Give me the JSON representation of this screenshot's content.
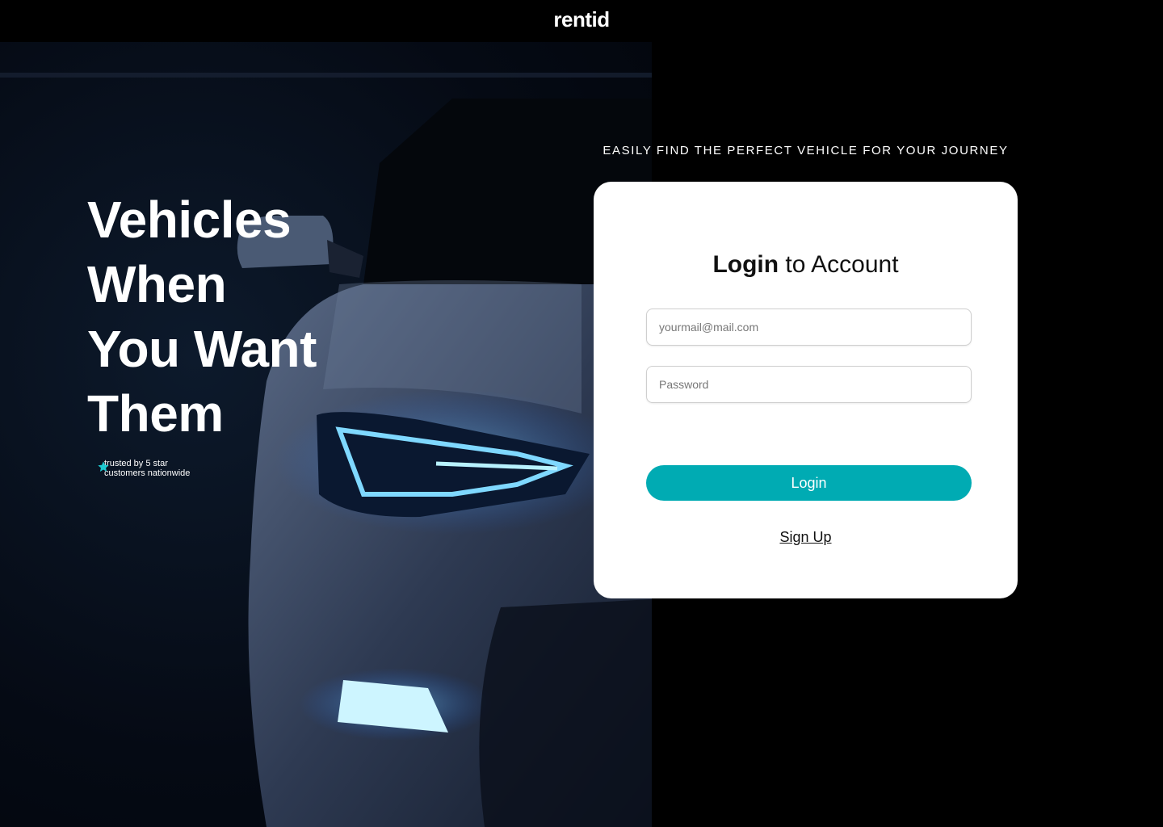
{
  "header": {
    "logo": "rentid"
  },
  "hero": {
    "headline_lines": [
      "Vehicles",
      "When",
      "You Want",
      "Them"
    ],
    "trust_icon": "star-icon",
    "trust_text_line1": "trusted by 5 star",
    "trust_text_line2": "customers nationwide"
  },
  "login": {
    "tagline": "EASILY FIND THE PERFECT VEHICLE FOR YOUR JOURNEY",
    "title_bold": "Login",
    "title_rest": " to Account",
    "email_placeholder": "yourmail@mail.com",
    "password_placeholder": "Password",
    "login_button": "Login",
    "signup_link": "Sign Up"
  },
  "colors": {
    "accent": "#00abb3",
    "background": "#000000",
    "card": "#ffffff",
    "star": "#1ec8d0"
  }
}
